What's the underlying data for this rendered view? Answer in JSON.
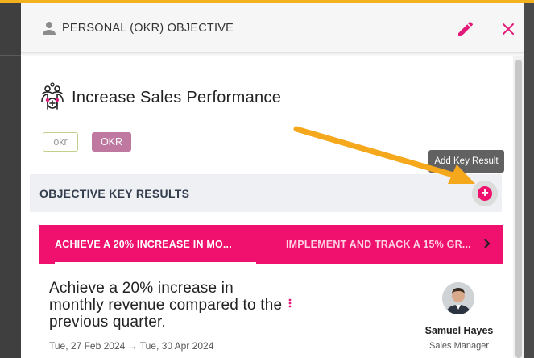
{
  "header": {
    "title": "PERSONAL (OKR) OBJECTIVE",
    "icons": {
      "person": "person-icon",
      "edit": "pencil-icon",
      "close": "close-icon"
    }
  },
  "objective": {
    "icon": "team-objective-icon",
    "title": "Increase Sales Performance",
    "tags": [
      "okr",
      "OKR"
    ]
  },
  "key_results": {
    "section_title": "OBJECTIVE KEY RESULTS",
    "add_tooltip": "Add Key Result",
    "add_icon": "plus-icon",
    "tabs": [
      {
        "label": "ACHIEVE A 20% INCREASE IN MO...",
        "active": true
      },
      {
        "label": "IMPLEMENT AND TRACK A 15% GR...",
        "active": false
      }
    ],
    "next_icon": "chevron-right-icon",
    "selected": {
      "name": "Achieve a 20% increase in monthly revenue compared to the previous quarter.",
      "dates": "Tue, 27 Feb 2024 → Tue, 30 Apr 2024",
      "menu_icon": "more-vertical-icon",
      "owner": {
        "name": "Samuel Hayes",
        "role": "Sales Manager",
        "avatar_icon": "avatar"
      }
    }
  },
  "colors": {
    "accent": "#f0106d",
    "annotation_arrow": "#f5a81c",
    "tag_OKR_bg": "#bf78a0",
    "top_stripe": "#f3b21d"
  }
}
